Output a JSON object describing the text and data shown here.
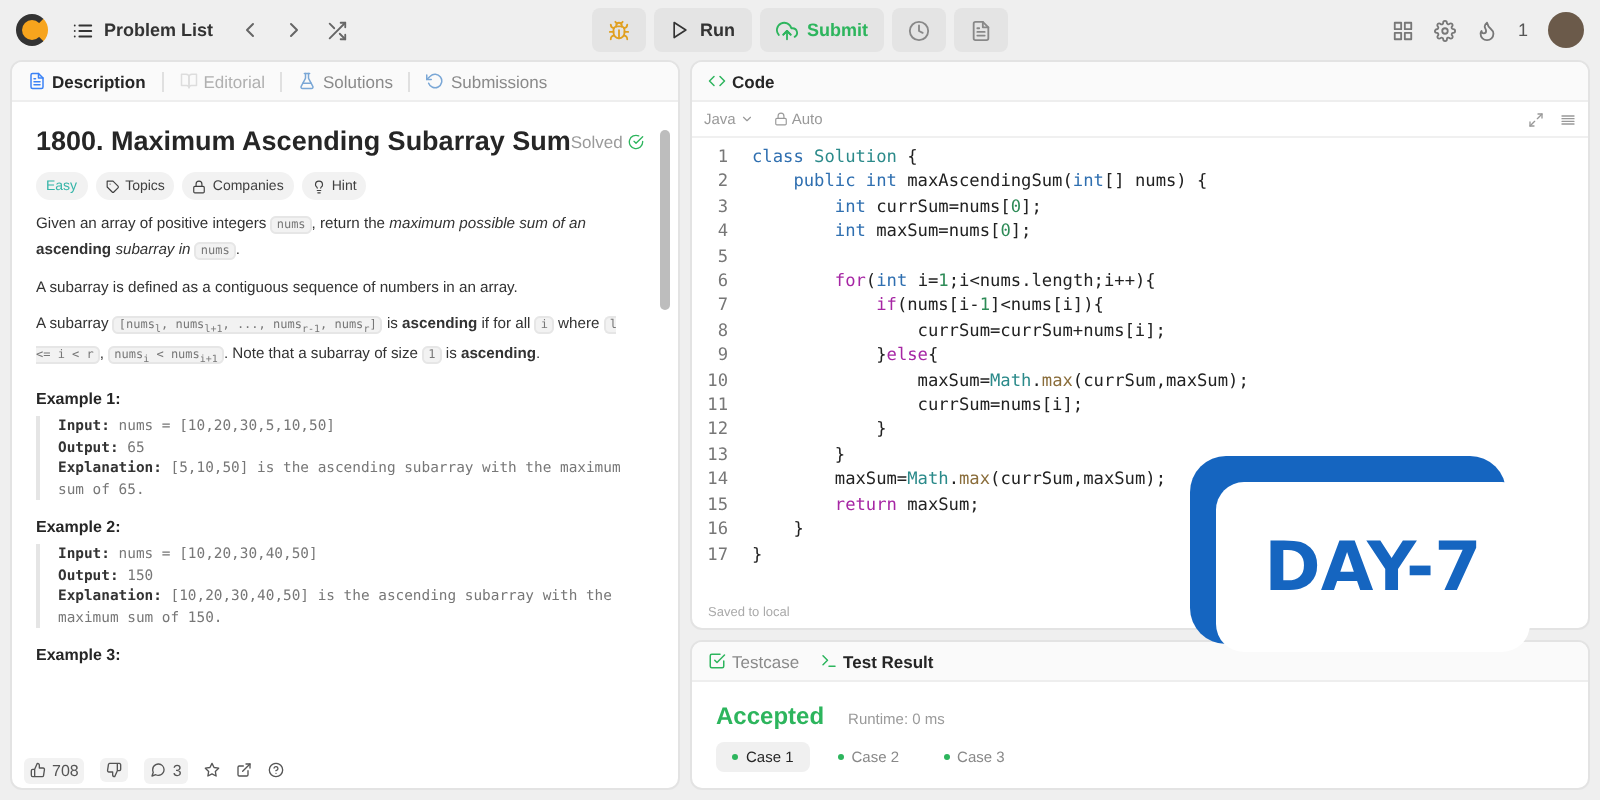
{
  "top_bar": {
    "problem_list": "Problem List",
    "run": "Run",
    "submit": "Submit",
    "streak": "1"
  },
  "description_panel": {
    "tabs": [
      {
        "label": "Description",
        "selected": true,
        "disabled": false
      },
      {
        "label": "Editorial",
        "selected": false,
        "disabled": true
      },
      {
        "label": "Solutions",
        "selected": false,
        "disabled": false
      },
      {
        "label": "Submissions",
        "selected": false,
        "disabled": false
      }
    ],
    "title": "1800. Maximum Ascending Subarray Sum",
    "status": "Solved",
    "tags": [
      {
        "label": "Easy",
        "kind": "difficulty"
      },
      {
        "label": "Topics",
        "kind": "topics"
      },
      {
        "label": "Companies",
        "kind": "companies"
      },
      {
        "label": "Hint",
        "kind": "hint"
      }
    ],
    "paragraphs": [
      [
        {
          "kind": "text",
          "s": "Given an array of positive integers "
        },
        {
          "kind": "code",
          "s": "nums"
        },
        {
          "kind": "text",
          "s": ", return the *maximum possible sum of an* **ascending** *subarray in* "
        },
        {
          "kind": "code",
          "s": "nums"
        },
        {
          "kind": "text",
          "s": "."
        }
      ],
      [
        {
          "kind": "text",
          "s": "A subarray is defined as a contiguous sequence of numbers in an array."
        }
      ],
      [
        {
          "kind": "text",
          "s": "A subarray "
        },
        {
          "kind": "code",
          "s": "[nums$_{l}$, nums$_{l+1}$, ..., nums$_{r-1}$, nums$_{r}$]"
        },
        {
          "kind": "text",
          "s": " is **ascending** if for all "
        },
        {
          "kind": "code",
          "s": "i"
        },
        {
          "kind": "text",
          "s": " where "
        },
        {
          "kind": "code",
          "s": "l <= i < r"
        },
        {
          "kind": "text",
          "s": ", "
        },
        {
          "kind": "code",
          "s": "nums$_{i}$ < nums$_{i+1}$"
        },
        {
          "kind": "text",
          "s": ". Note that a subarray of size "
        },
        {
          "kind": "code",
          "s": "1"
        },
        {
          "kind": "text",
          "s": " is **ascending**."
        }
      ]
    ],
    "examples": [
      {
        "heading": "Example 1:",
        "lines": [
          {
            "label": "Input:",
            "value": "nums = [10,20,30,5,10,50]"
          },
          {
            "label": "Output:",
            "value": "65"
          },
          {
            "label": "Explanation:",
            "value": "[5,10,50] is the ascending subarray with the maximum sum of 65."
          }
        ]
      },
      {
        "heading": "Example 2:",
        "lines": [
          {
            "label": "Input:",
            "value": "nums = [10,20,30,40,50]"
          },
          {
            "label": "Output:",
            "value": "150"
          },
          {
            "label": "Explanation:",
            "value": "[10,20,30,40,50] is the ascending subarray with the maximum sum of 150."
          }
        ]
      },
      {
        "heading": "Example 3:"
      }
    ],
    "footer": {
      "likes": "708",
      "comments": "3"
    }
  },
  "code_panel": {
    "title": "Code",
    "language": "Java",
    "mode": "Auto",
    "status": "Saved to local",
    "lines": [
      {
        "number": "1",
        "tokens": [
          {
            "kind": "kw",
            "s": "class"
          },
          {
            "kind": "type",
            "s": " Solution"
          },
          {
            "kind": "plain",
            "s": " {"
          }
        ]
      },
      {
        "number": "2",
        "tokens": [
          {
            "kind": "kw",
            "s": "    public"
          },
          {
            "kind": "kw",
            "s": " int"
          },
          {
            "kind": "plain",
            "s": " maxAscendingSum("
          },
          {
            "kind": "kw",
            "s": "int"
          },
          {
            "kind": "plain",
            "s": "[] nums) {"
          }
        ]
      },
      {
        "number": "3",
        "tokens": [
          {
            "kind": "kw",
            "s": "        int"
          },
          {
            "kind": "plain",
            "s": " currSum=nums["
          },
          {
            "kind": "num",
            "s": "0"
          },
          {
            "kind": "plain",
            "s": "];"
          }
        ]
      },
      {
        "number": "4",
        "tokens": [
          {
            "kind": "kw",
            "s": "        int"
          },
          {
            "kind": "plain",
            "s": " maxSum=nums["
          },
          {
            "kind": "num",
            "s": "0"
          },
          {
            "kind": "plain",
            "s": "];"
          }
        ]
      },
      {
        "number": "5"
      },
      {
        "number": "6",
        "tokens": [
          {
            "kind": "ctrl",
            "s": "        for"
          },
          {
            "kind": "plain",
            "s": "("
          },
          {
            "kind": "kw",
            "s": "int"
          },
          {
            "kind": "plain",
            "s": " i="
          },
          {
            "kind": "num",
            "s": "1"
          },
          {
            "kind": "plain",
            "s": ";i<nums.length;i++){"
          }
        ]
      },
      {
        "number": "7",
        "tokens": [
          {
            "kind": "ctrl",
            "s": "            if"
          },
          {
            "kind": "plain",
            "s": "(nums[i-"
          },
          {
            "kind": "num",
            "s": "1"
          },
          {
            "kind": "plain",
            "s": "]<nums[i]){"
          }
        ]
      },
      {
        "number": "8",
        "tokens": [
          {
            "kind": "plain",
            "s": "                currSum=currSum+nums[i];"
          }
        ]
      },
      {
        "number": "9",
        "tokens": [
          {
            "kind": "plain",
            "s": "            }"
          },
          {
            "kind": "ctrl",
            "s": "else"
          },
          {
            "kind": "plain",
            "s": "{"
          }
        ]
      },
      {
        "number": "10",
        "tokens": [
          {
            "kind": "plain",
            "s": "                maxSum="
          },
          {
            "kind": "type",
            "s": "Math"
          },
          {
            "kind": "plain",
            "s": "."
          },
          {
            "kind": "fn",
            "s": "max"
          },
          {
            "kind": "plain",
            "s": "(currSum,maxSum);"
          }
        ]
      },
      {
        "number": "11",
        "tokens": [
          {
            "kind": "plain",
            "s": "                currSum=nums[i];"
          }
        ]
      },
      {
        "number": "12",
        "tokens": [
          {
            "kind": "plain",
            "s": "            }"
          }
        ]
      },
      {
        "number": "13",
        "tokens": [
          {
            "kind": "plain",
            "s": "        }"
          }
        ]
      },
      {
        "number": "14",
        "tokens": [
          {
            "kind": "plain",
            "s": "        maxSum="
          },
          {
            "kind": "type",
            "s": "Math"
          },
          {
            "kind": "plain",
            "s": "."
          },
          {
            "kind": "fn",
            "s": "max"
          },
          {
            "kind": "plain",
            "s": "(currSum,maxSum);"
          }
        ]
      },
      {
        "number": "15",
        "tokens": [
          {
            "kind": "ctrl",
            "s": "        return"
          },
          {
            "kind": "plain",
            "s": " maxSum;"
          }
        ]
      },
      {
        "number": "16",
        "tokens": [
          {
            "kind": "plain",
            "s": "    }"
          }
        ]
      },
      {
        "number": "17",
        "tokens": [
          {
            "kind": "plain",
            "s": "}"
          }
        ]
      }
    ]
  },
  "test_panel": {
    "tabs": [
      {
        "label": "Testcase",
        "selected": false
      },
      {
        "label": "Test Result",
        "selected": true
      }
    ],
    "verdict": "Accepted",
    "runtime": "Runtime: 0 ms",
    "cases": [
      {
        "label": "Case 1",
        "selected": true
      },
      {
        "label": "Case 2",
        "selected": false
      },
      {
        "label": "Case 3",
        "selected": false
      }
    ]
  },
  "overlay": {
    "text": "DAY-7"
  }
}
